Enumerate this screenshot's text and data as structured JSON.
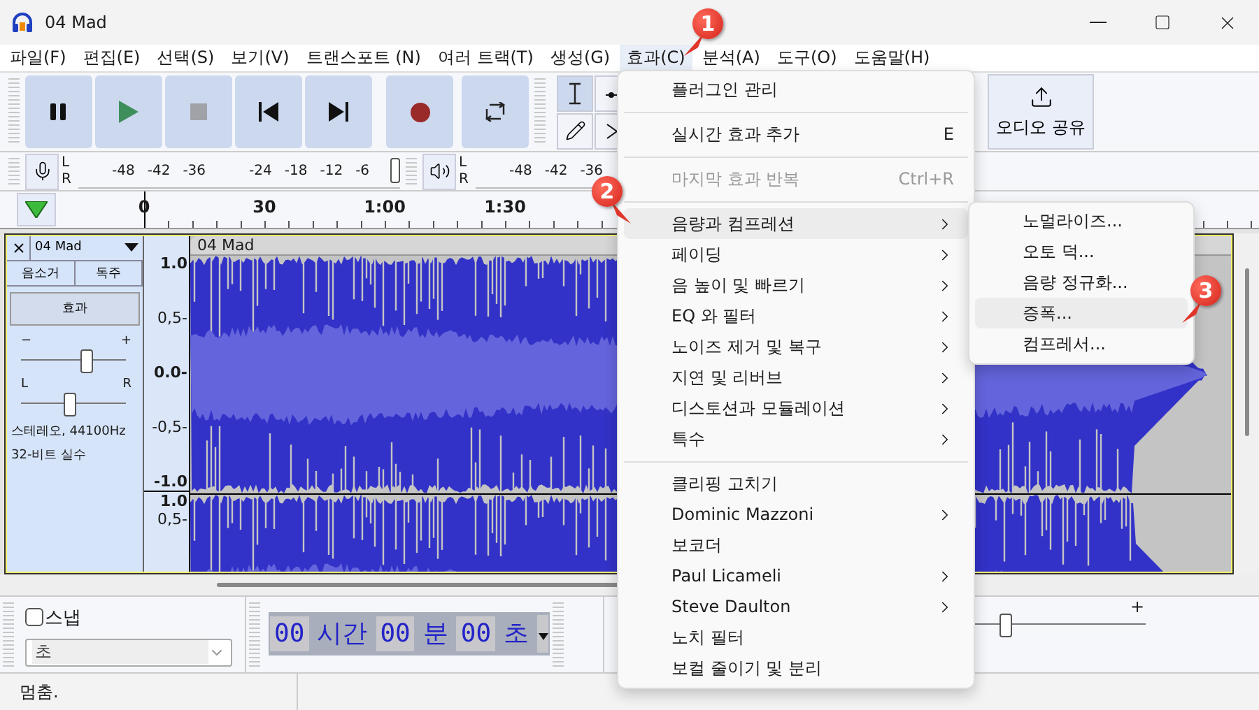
{
  "window": {
    "title": "04 Mad"
  },
  "menu_bar": [
    {
      "label": "파일(F)",
      "selected": false
    },
    {
      "label": "편집(E)",
      "selected": false
    },
    {
      "label": "선택(S)",
      "selected": false
    },
    {
      "label": "보기(V)",
      "selected": false
    },
    {
      "label": "트랜스포트 (N)",
      "selected": false
    },
    {
      "label": "여러 트랙(T)",
      "selected": false
    },
    {
      "label": "생성(G)",
      "selected": false
    },
    {
      "label": "효과(C)",
      "selected": true
    },
    {
      "label": "분석(A)",
      "selected": false
    },
    {
      "label": "도구(O)",
      "selected": false
    },
    {
      "label": "도움말(H)",
      "selected": false
    }
  ],
  "share_button": {
    "label": "오디오 공유"
  },
  "record_meter": {
    "channels": [
      "L",
      "R"
    ],
    "ticks": [
      "-48",
      "-42",
      "-36",
      "-24",
      "-18",
      "-12",
      "-6"
    ]
  },
  "playback_meter": {
    "channels": [
      "L",
      "R"
    ],
    "ticks": [
      "-48",
      "-42",
      "-36"
    ]
  },
  "timeline": {
    "ticks": [
      "0",
      "30",
      "1:00",
      "1:30"
    ]
  },
  "track": {
    "name": "04 Mad",
    "buttons": [
      "음소거",
      "독주"
    ],
    "effects_button": "효과",
    "gain_slider": {
      "min_label": "−",
      "max_label": "+",
      "level": 0.62
    },
    "pan_slider": {
      "min_label": "L",
      "max_label": "R",
      "level": 0.47
    },
    "info": [
      "스테레오, 44100Hz",
      "32-비트 실수"
    ],
    "clip_title": "04 Mad",
    "channels": [
      {
        "labels": [
          "1.0",
          "0,5-",
          "0.0-",
          "-0,5-",
          "-1.0"
        ]
      },
      {
        "labels": [
          "1.0",
          "0,5-"
        ]
      }
    ]
  },
  "snap": {
    "label": "스냅",
    "checked": false,
    "unit": "초"
  },
  "time_display": {
    "parts": [
      {
        "kind": "digits",
        "text": "00"
      },
      {
        "kind": "unit",
        "text": "시간"
      },
      {
        "kind": "digits",
        "text": "00"
      },
      {
        "kind": "unit",
        "text": "분"
      },
      {
        "kind": "digits",
        "text": "00"
      },
      {
        "kind": "unit",
        "text": "초"
      }
    ]
  },
  "speed_slider": {
    "max_label": "+",
    "level": 0.2
  },
  "status_bar": {
    "text": "멈춤."
  },
  "effect_menu": [
    {
      "kind": "item",
      "label": "플러그인 관리",
      "submenu": false,
      "disabled": false,
      "selected": false
    },
    {
      "kind": "separator"
    },
    {
      "kind": "item",
      "label": "실시간 효과 추가",
      "shortcut": "E",
      "submenu": false,
      "disabled": false,
      "selected": false
    },
    {
      "kind": "separator"
    },
    {
      "kind": "item",
      "label": "마지막 효과 반복",
      "shortcut": "Ctrl+R",
      "submenu": false,
      "disabled": true,
      "selected": false
    },
    {
      "kind": "separator"
    },
    {
      "kind": "item",
      "label": "음량과 컴프레션",
      "submenu": true,
      "disabled": false,
      "selected": true
    },
    {
      "kind": "item",
      "label": "페이딩",
      "submenu": true,
      "disabled": false,
      "selected": false
    },
    {
      "kind": "item",
      "label": "음 높이 및 빠르기",
      "submenu": true,
      "disabled": false,
      "selected": false
    },
    {
      "kind": "item",
      "label": "EQ 와 필터",
      "submenu": true,
      "disabled": false,
      "selected": false
    },
    {
      "kind": "item",
      "label": "노이즈 제거 및 복구",
      "submenu": true,
      "disabled": false,
      "selected": false
    },
    {
      "kind": "item",
      "label": "지연 및 리버브",
      "submenu": true,
      "disabled": false,
      "selected": false
    },
    {
      "kind": "item",
      "label": "디스토션과 모듈레이션",
      "submenu": true,
      "disabled": false,
      "selected": false
    },
    {
      "kind": "item",
      "label": "특수",
      "submenu": true,
      "disabled": false,
      "selected": false
    },
    {
      "kind": "separator"
    },
    {
      "kind": "item",
      "label": "클리핑 고치기",
      "submenu": false,
      "disabled": false,
      "selected": false
    },
    {
      "kind": "item",
      "label": "Dominic Mazzoni",
      "submenu": true,
      "disabled": false,
      "selected": false
    },
    {
      "kind": "item",
      "label": "보코더",
      "submenu": false,
      "disabled": false,
      "selected": false
    },
    {
      "kind": "item",
      "label": "Paul Licameli",
      "submenu": true,
      "disabled": false,
      "selected": false
    },
    {
      "kind": "item",
      "label": "Steve Daulton",
      "submenu": true,
      "disabled": false,
      "selected": false
    },
    {
      "kind": "item",
      "label": "노치 필터",
      "submenu": false,
      "disabled": false,
      "selected": false
    },
    {
      "kind": "item",
      "label": "보컬 줄이기 및 분리",
      "submenu": false,
      "disabled": false,
      "selected": false
    }
  ],
  "submenu": [
    {
      "label": "노멀라이즈...",
      "selected": false
    },
    {
      "label": "오토 덕...",
      "selected": false
    },
    {
      "label": "음량 정규화...",
      "selected": false
    },
    {
      "label": "증폭...",
      "selected": true
    },
    {
      "label": "컴프레서...",
      "selected": false
    }
  ],
  "callouts": [
    "1",
    "2",
    "3"
  ]
}
